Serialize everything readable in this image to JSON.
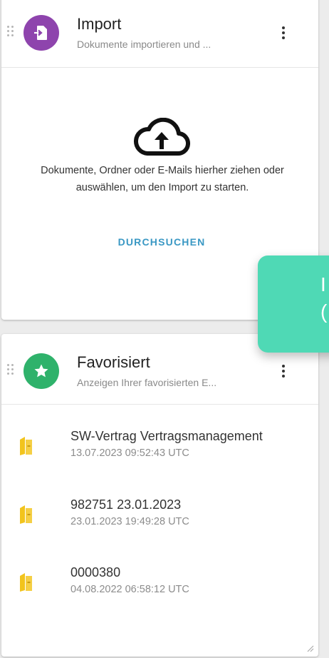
{
  "import_card": {
    "title": "Import",
    "subtitle": "Dokumente importieren und ...",
    "accent_color": "#8e44ad",
    "icon": "import-document-icon",
    "upload": {
      "icon": "cloud-upload-icon",
      "text": "Dokumente, Ordner oder E-Mails hierher ziehen oder auswählen, um den Import zu starten.",
      "browse_label": "DURCHSUCHEN"
    },
    "menu_icon": "more-vert-icon"
  },
  "favorites_card": {
    "title": "Favorisiert",
    "subtitle": "Anzeigen Ihrer favorisierten E...",
    "accent_color": "#2fb26b",
    "icon": "star-icon",
    "menu_icon": "more-vert-icon",
    "items": [
      {
        "name": "SW-Vertrag Vertragsmanagement",
        "date": "13.07.2023 09:52:43 UTC",
        "icon": "folder-binder-icon"
      },
      {
        "name": "982751 23.01.2023",
        "date": "23.01.2023 19:49:28 UTC",
        "icon": "folder-binder-icon"
      },
      {
        "name": "0000380",
        "date": "04.08.2022 06:58:12 UTC",
        "icon": "folder-binder-icon"
      }
    ]
  },
  "overlay": {
    "color": "#4fd9b5",
    "text_partial": "(",
    "text_partial_top": "I"
  }
}
